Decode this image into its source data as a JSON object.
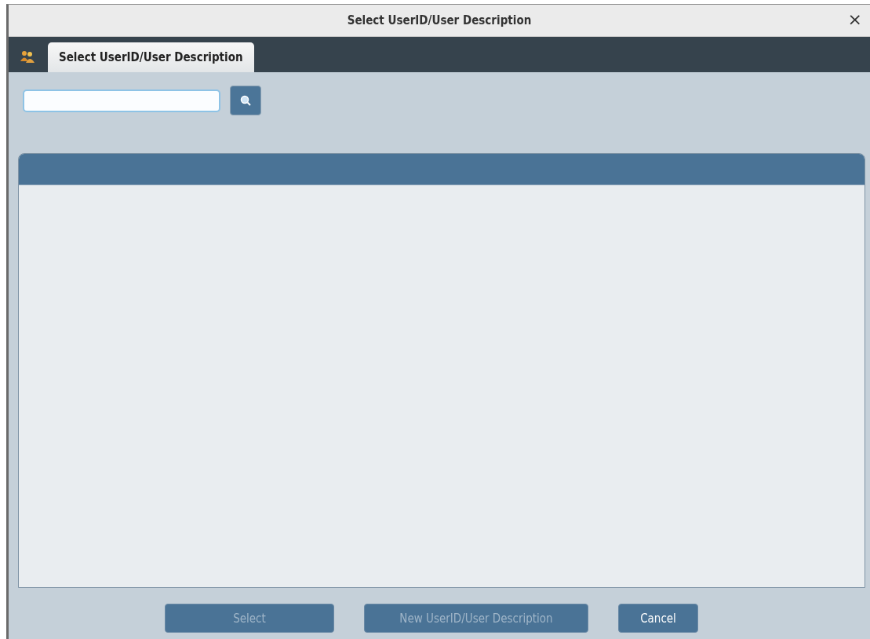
{
  "window": {
    "title": "Select UserID/User Description",
    "close": "×"
  },
  "tabs": [
    {
      "label": "Select UserID/User Description",
      "selected": true
    }
  ],
  "buttons": [
    {
      "label": "Select",
      "disabled": true
    },
    {
      "label": "New UserID/User Description",
      "disabled": true
    },
    {
      "label": "Cancel",
      "disabled": false
    }
  ]
}
